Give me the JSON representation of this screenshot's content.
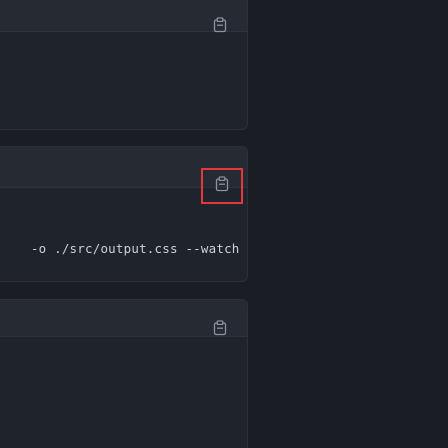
{
  "code_blocks": [
    {
      "id": "block-1",
      "copy_icon": "clipboard-icon",
      "code": ""
    },
    {
      "id": "block-2",
      "copy_icon": "clipboard-icon",
      "focused": true,
      "code": {
        "opt": "-o",
        "path": "./src/output.css",
        "flag": "--watch"
      }
    },
    {
      "id": "block-3",
      "copy_icon": "clipboard-icon",
      "code": ""
    }
  ],
  "colors": {
    "background": "#1a1d24",
    "card": "#1f232b",
    "card_header": "#252a33",
    "focus_outline": "#e5383b",
    "text": "#c9d1d9"
  }
}
